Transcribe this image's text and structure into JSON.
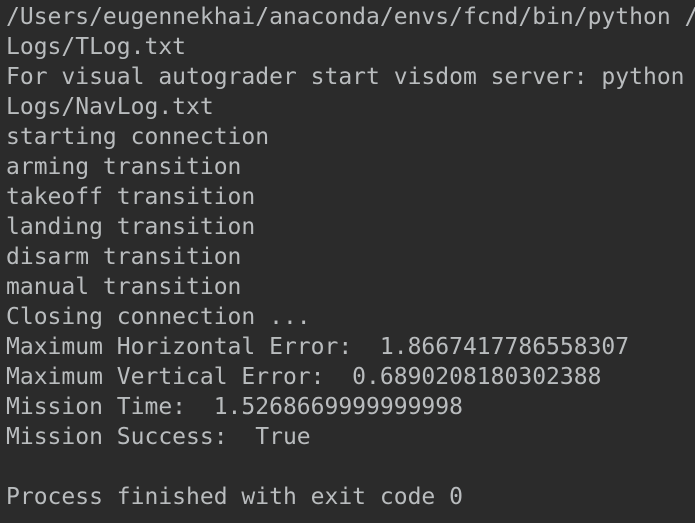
{
  "console": {
    "lines": [
      "/Users/eugennekhai/anaconda/envs/fcnd/bin/python /",
      "Logs/TLog.txt",
      "For visual autograder start visdom server: python",
      "Logs/NavLog.txt",
      "starting connection",
      "arming transition",
      "takeoff transition",
      "landing transition",
      "disarm transition",
      "manual transition",
      "Closing connection ...",
      "Maximum Horizontal Error:  1.8667417786558307",
      "Maximum Vertical Error:  0.6890208180302388",
      "Mission Time:  1.5268669999999998",
      "Mission Success:  True",
      "",
      "Process finished with exit code 0"
    ]
  },
  "colors": {
    "background": "#2b2b2b",
    "text": "#b9bcbe"
  }
}
